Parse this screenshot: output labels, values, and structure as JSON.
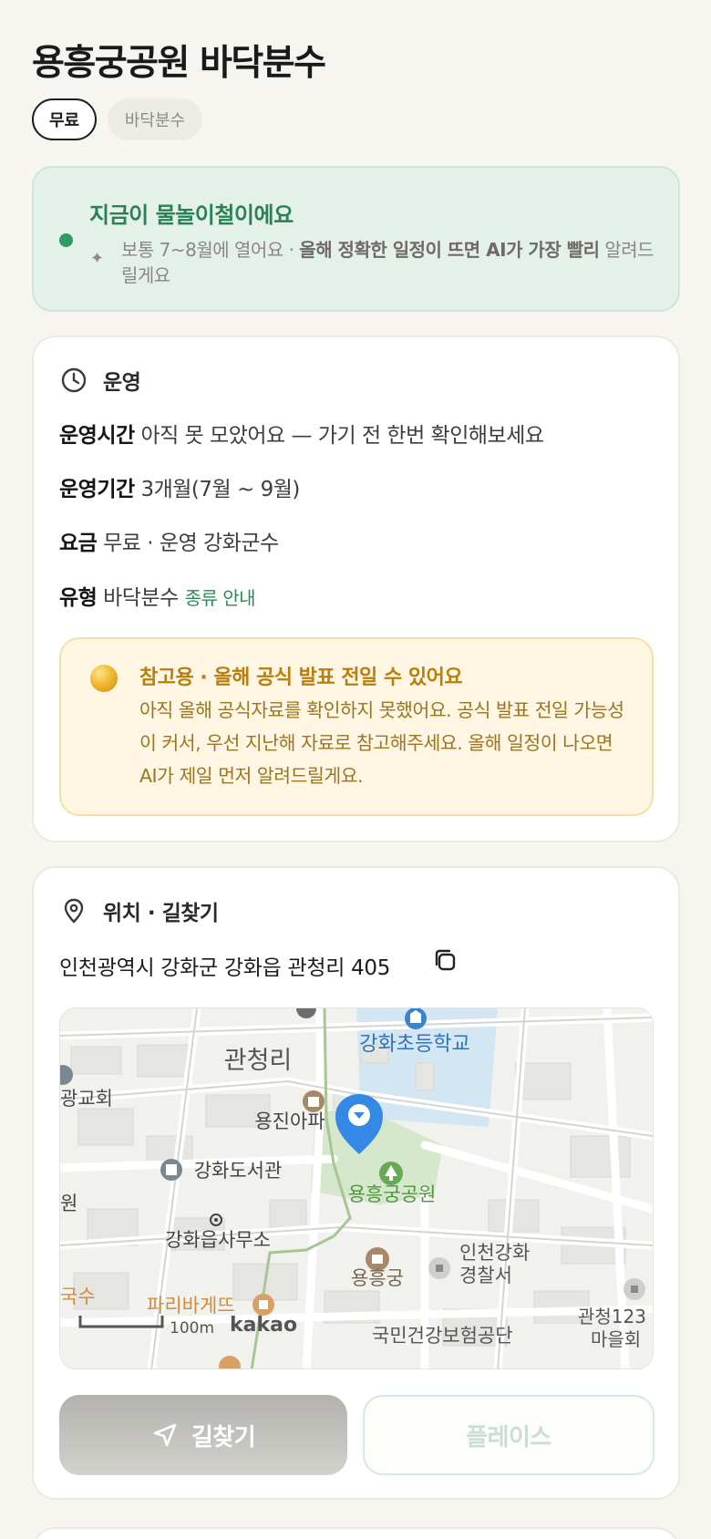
{
  "title": "용흥궁공원 바닥분수",
  "chips": {
    "price": "무료",
    "type": "바닥분수"
  },
  "season": {
    "title": "지금이 물놀이철이에요",
    "desc_plain": "보통 7~8월에 열어요 · ",
    "desc_bold": "올해 정확한 일정이 뜨면 AI가 가장 빨리",
    "desc_tail": " 알려드릴게요",
    "accent_color": "#2f9a62"
  },
  "operation": {
    "heading": "운영",
    "hours_label": "운영시간",
    "hours_value": "아직 못 모았어요 — 가기 전 한번 확인해보세요",
    "period_label": "운영기간",
    "period_value": "3개월(7월 ~ 9월)",
    "fee_label": "요금",
    "fee_value": "무료 · 운영 강화군수",
    "type_label": "유형",
    "type_value": "바닥분수",
    "type_link": "종류 안내",
    "notice_title": "참고용 · 올해 공식 발표 전일 수 있어요",
    "notice_body": "아직 올해 공식자료를 확인하지 못했어요. 공식 발표 전일 가능성이 커서, 우선 지난해 자료로 참고해주세요. 올해 일정이 나오면 AI가 제일 먼저 알려드릴게요."
  },
  "location": {
    "heading": "위치 · 길찾기",
    "address": "인천광역시 강화군 강화읍 관청리 405",
    "map_labels": {
      "area": "관청리",
      "school": "강화초등학교",
      "church": "광교회",
      "apartment": "용진아파",
      "library": "강화도서관",
      "won": "원",
      "office": "강화읍사무소",
      "park": "용흥궁공원",
      "palace": "용흥궁",
      "police1": "인천강화",
      "police2": "경찰서",
      "bakery": "파리바게뜨",
      "noodle": "국수",
      "insurance": "국민건강보험공단",
      "center1": "관청123",
      "center2": "마을회",
      "scale": "100m",
      "brand": "kakao"
    },
    "route_button": "길찾기",
    "place_button": "플레이스"
  }
}
